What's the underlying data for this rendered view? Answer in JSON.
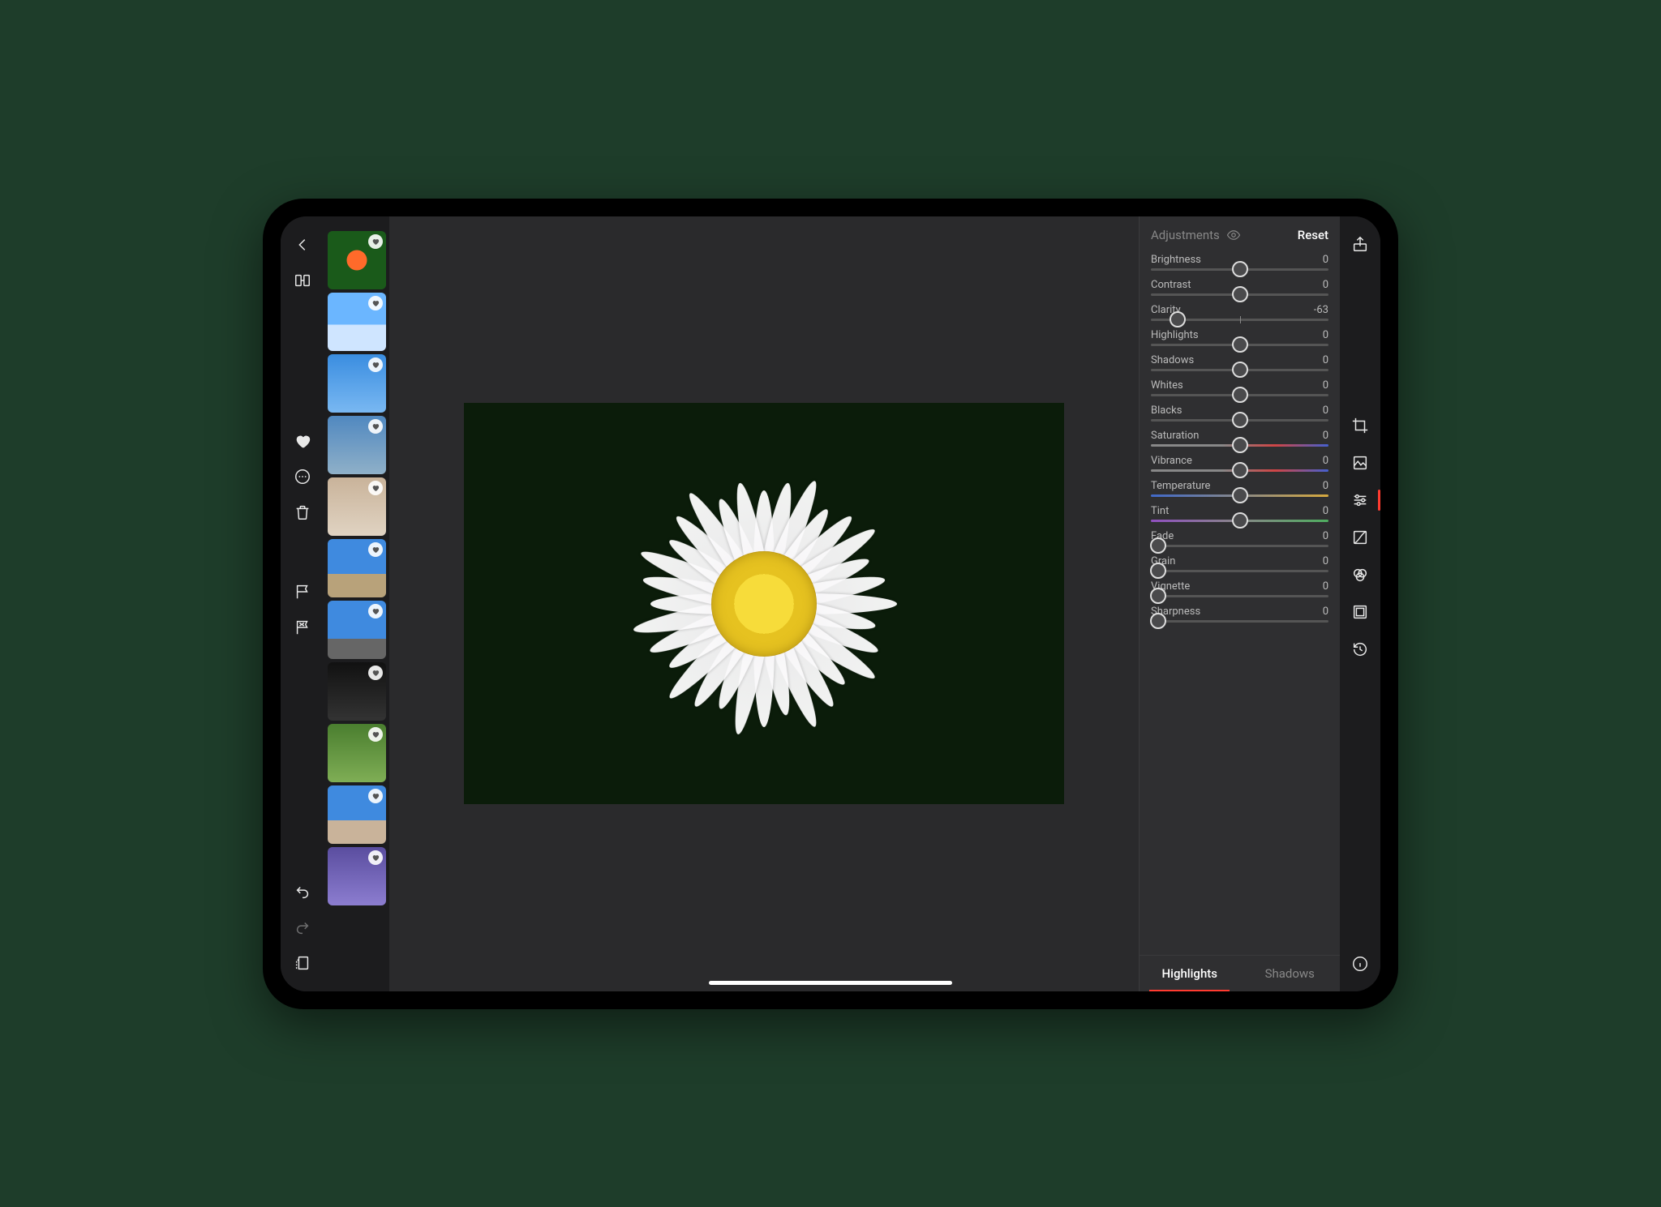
{
  "panel": {
    "title": "Adjustments",
    "reset_label": "Reset"
  },
  "sliders": [
    {
      "id": "brightness",
      "label": "Brightness",
      "value": 0,
      "pos": 50,
      "track": "plain",
      "center": true
    },
    {
      "id": "contrast",
      "label": "Contrast",
      "value": 0,
      "pos": 50,
      "track": "plain",
      "center": true
    },
    {
      "id": "clarity",
      "label": "Clarity",
      "value": -63,
      "pos": 15,
      "track": "plain",
      "center": true
    },
    {
      "id": "highlights",
      "label": "Highlights",
      "value": 0,
      "pos": 50,
      "track": "plain",
      "center": true
    },
    {
      "id": "shadows",
      "label": "Shadows",
      "value": 0,
      "pos": 50,
      "track": "plain",
      "center": true
    },
    {
      "id": "whites",
      "label": "Whites",
      "value": 0,
      "pos": 50,
      "track": "plain",
      "center": true
    },
    {
      "id": "blacks",
      "label": "Blacks",
      "value": 0,
      "pos": 50,
      "track": "plain",
      "center": true
    },
    {
      "id": "saturation",
      "label": "Saturation",
      "value": 0,
      "pos": 50,
      "track": "sat",
      "center": true
    },
    {
      "id": "vibrance",
      "label": "Vibrance",
      "value": 0,
      "pos": 50,
      "track": "vib",
      "center": true
    },
    {
      "id": "temperature",
      "label": "Temperature",
      "value": 0,
      "pos": 50,
      "track": "temp",
      "center": true
    },
    {
      "id": "tint",
      "label": "Tint",
      "value": 0,
      "pos": 50,
      "track": "tint",
      "center": true
    },
    {
      "id": "fade",
      "label": "Fade",
      "value": 0,
      "pos": 4,
      "track": "plain",
      "center": false
    },
    {
      "id": "grain",
      "label": "Grain",
      "value": 0,
      "pos": 4,
      "track": "plain",
      "center": false
    },
    {
      "id": "vignette",
      "label": "Vignette",
      "value": 0,
      "pos": 4,
      "track": "plain",
      "center": false
    },
    {
      "id": "sharpness",
      "label": "Sharpness",
      "value": 0,
      "pos": 4,
      "track": "plain",
      "center": false
    }
  ],
  "subtabs": {
    "highlights": "Highlights",
    "shadows": "Shadows",
    "active": "highlights"
  },
  "thumbnails": [
    {
      "id": "t1",
      "name": "orange-flower"
    },
    {
      "id": "t2",
      "name": "sky-flag"
    },
    {
      "id": "t3",
      "name": "buildings-sky"
    },
    {
      "id": "t4",
      "name": "spire"
    },
    {
      "id": "t5",
      "name": "wall"
    },
    {
      "id": "t6",
      "name": "columns"
    },
    {
      "id": "t7",
      "name": "skyscraper"
    },
    {
      "id": "t8",
      "name": "dark-building"
    },
    {
      "id": "t9",
      "name": "yellow-flowers"
    },
    {
      "id": "t10",
      "name": "campus"
    },
    {
      "id": "t11",
      "name": "purple-flowers"
    }
  ],
  "right_tools": {
    "active_index": 2
  }
}
